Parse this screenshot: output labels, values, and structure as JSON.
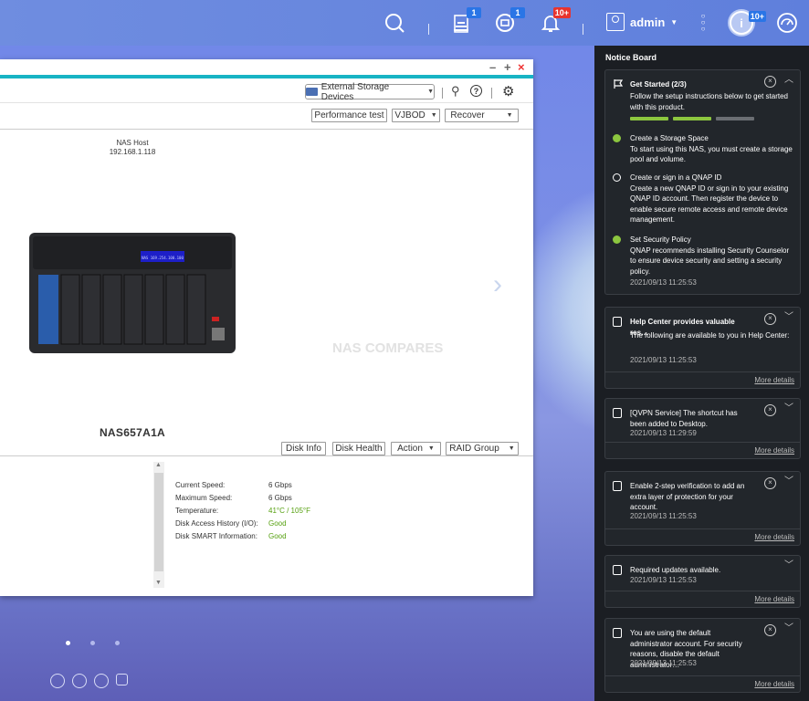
{
  "topbar": {
    "badges": {
      "tasks": "1",
      "sync": "1",
      "alerts": "10+",
      "notice": "10+"
    },
    "user": "admin"
  },
  "window": {
    "controls": {
      "minimize": "–",
      "maximize": "+",
      "close": "×"
    },
    "external_storage_label": "External Storage Devices",
    "buttons": {
      "performance_test": "Performance test",
      "vjbod": "VJBOD",
      "recover": "Recover",
      "disk_info": "Disk Info",
      "disk_health": "Disk Health",
      "action": "Action",
      "raid_group": "RAID Group"
    },
    "host_label": "NAS Host",
    "host_ip": "192.168.1.118",
    "model": "NAS657A1A",
    "watermark": "NAS COMPARES",
    "lcd_text": "NAS 169.254.100.100",
    "details": [
      {
        "label": "Current Speed:",
        "value": "6 Gbps",
        "status": false
      },
      {
        "label": "Maximum Speed:",
        "value": "6 Gbps",
        "status": false
      },
      {
        "label": "Temperature:",
        "value": "41°C / 105°F",
        "status": true
      },
      {
        "label": "Disk Access History (I/O):",
        "value": "Good",
        "status": true
      },
      {
        "label": "Disk SMART Information:",
        "value": "Good",
        "status": true
      }
    ]
  },
  "notice_board": {
    "title": "Notice Board",
    "get_started": {
      "title": "Get Started (2/3)",
      "subtitle": "Follow the setup instructions below to get started with this product.",
      "progress_colors": [
        "#8cc63f",
        "#8cc63f",
        "#6b6e73"
      ],
      "steps": [
        {
          "title": "Create a Storage Space",
          "desc": "To start using this NAS, you must create a storage pool and volume.",
          "done": true
        },
        {
          "title": "Create or sign in a QNAP ID",
          "desc": "Create a new QNAP ID or sign in to your existing QNAP ID account. Then register the device to enable secure remote access and remote device management.",
          "done": false
        },
        {
          "title": "Set Security Policy",
          "desc": "QNAP recommends installing Security Counselor to ensure device security and setting a security policy.",
          "done": true
        }
      ],
      "timestamp": "2021/09/13 11:25:53"
    },
    "cards": [
      {
        "title": "Help Center provides valuable res…",
        "body": "The following are available to you in Help Center:",
        "timestamp": "2021/09/13 11:25:53",
        "more": "More details"
      },
      {
        "title": "[QVPN Service] The shortcut has been added to Desktop.",
        "body": "",
        "timestamp": "2021/09/13 11:29:59",
        "more": "More details"
      },
      {
        "title": "Enable 2-step verification to add an extra layer of protection for your account.",
        "body": "",
        "timestamp": "2021/09/13 11:25:53",
        "more": "More details"
      },
      {
        "title": "Required updates available.",
        "body": "",
        "timestamp": "2021/09/13 11:25:53",
        "more": "More details"
      },
      {
        "title": "You are using the default administrator account. For security reasons, disable the default administrator…",
        "body": "",
        "timestamp": "2021/09/13 11:25:53",
        "more": "More details"
      }
    ]
  },
  "colors": {
    "accent": "#17b4c4",
    "success": "#8cc63f",
    "alert": "#e8332e",
    "badge": "#2a75e6"
  }
}
